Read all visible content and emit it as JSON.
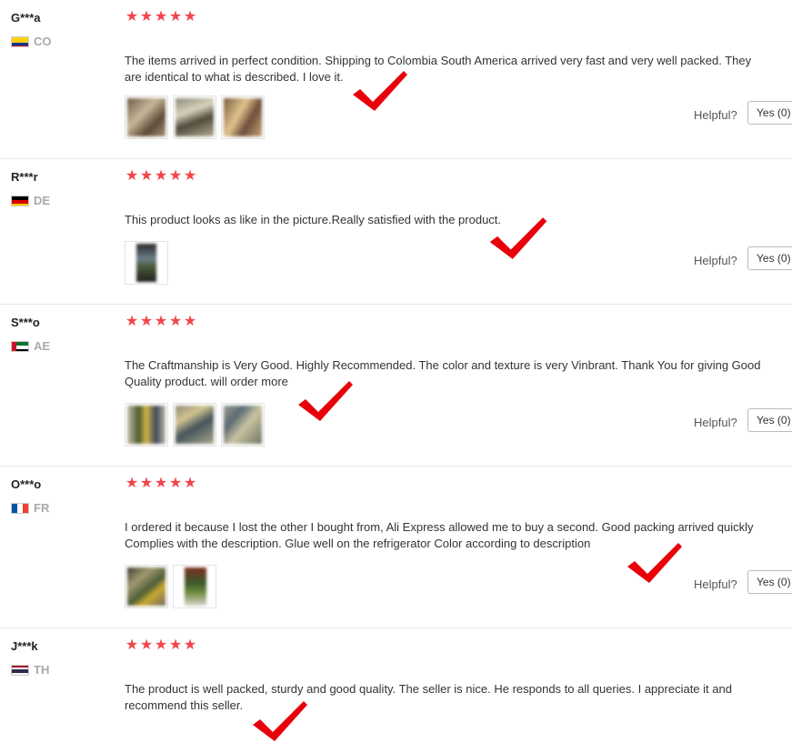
{
  "helpful_label": "Helpful?",
  "star_color": "#f0464a",
  "check_color": "#e8000b",
  "reviews": [
    {
      "user": "G***a",
      "country": "CO",
      "stars": 5,
      "text": "The items arrived in perfect condition. Shipping to Colombia South America arrived very fast and very well packed. They are identical to what is described. I love it.",
      "photo_count": 3,
      "yes_label": "Yes (0)"
    },
    {
      "user": "R***r",
      "country": "DE",
      "stars": 5,
      "text": "This product looks as like in the picture.Really satisfied with the product.",
      "photo_count": 1,
      "yes_label": "Yes (0)"
    },
    {
      "user": "S***o",
      "country": "AE",
      "stars": 5,
      "text": "The Craftmanship is Very Good. Highly Recommended. The color and texture is very Vinbrant. Thank You for giving Good Quality product. will order more",
      "photo_count": 3,
      "yes_label": "Yes (0)"
    },
    {
      "user": "O***o",
      "country": "FR",
      "stars": 5,
      "text": "I ordered it because I lost the other I bought from, Ali Express allowed me to buy a second. Good packing arrived quickly Complies with the description. Glue well on the refrigerator Color according to description",
      "photo_count": 2,
      "yes_label": "Yes (0)"
    },
    {
      "user": "J***k",
      "country": "TH",
      "stars": 5,
      "text": "The product is well packed, sturdy and good quality.  The seller is nice.  He responds to all queries.  I appreciate it and recommend this seller.",
      "photo_count": 0,
      "yes_label": ""
    }
  ]
}
